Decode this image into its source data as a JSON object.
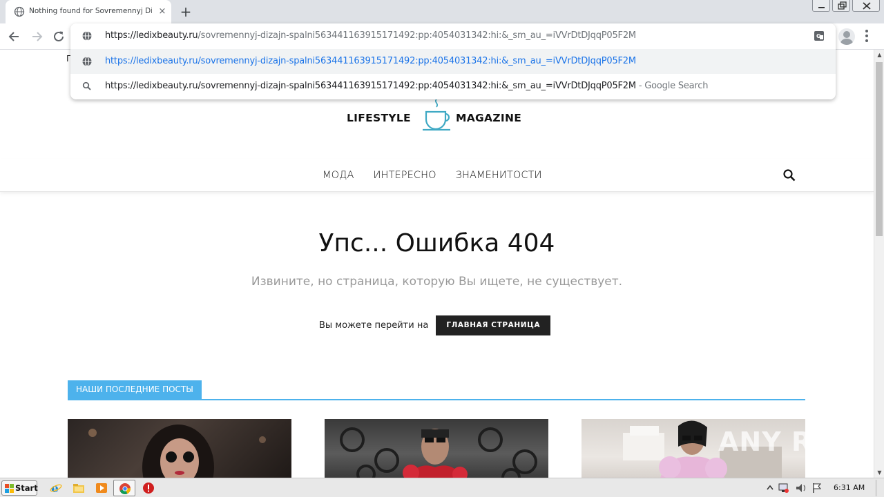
{
  "browser": {
    "tab_title": "Nothing found for Sovremennyj Dizajn Spalni",
    "tab_close_glyph": "×",
    "new_tab_glyph": "+"
  },
  "omnibox": {
    "input_host": "https://ledixbeauty.ru",
    "input_rest": "/sovremennyj-dizajn-spalni563441163915171492:pp:4054031342:hi:&_sm_au_=iVVrDtDJqqP05F2M",
    "suggestion_url": "https://ledixbeauty.ru/sovremennyj-dizajn-spalni563441163915171492:pp:4054031342:hi:&_sm_au_=iVVrDtDJqqP05F2M",
    "suggestion_search_query": "https://ledixbeauty.ru/sovremennyj-dizajn-spalni563441163915171492:pp:4054031342:hi:&_sm_au_=iVVrDtDJqqP05F2M",
    "suggestion_search_suffix": " - Google Search"
  },
  "page": {
    "top_letter": "П",
    "logo_left": "LIFESTYLE",
    "logo_right": "MAGAZINE",
    "nav": [
      "МОДА",
      "ИНТЕРЕСНО",
      "ЗНАМЕНИТОСТИ"
    ],
    "error_title": "Упс... Ошибка 404",
    "error_subtitle": "Извините, но страница, которую Вы ищете, не существует.",
    "goto_text": "Вы можете перейти на",
    "home_button": "ГЛАВНАЯ СТРАНИЦА",
    "posts_header": "НАШИ ПОСЛЕДНИЕ ПОСТЫ",
    "watermark": "ANY RUN"
  },
  "taskbar": {
    "start_label": "Start",
    "clock": "6:31 AM"
  },
  "colors": {
    "accent": "#4db2ec",
    "button_dark": "#222222",
    "link_blue": "#1a73e8"
  }
}
